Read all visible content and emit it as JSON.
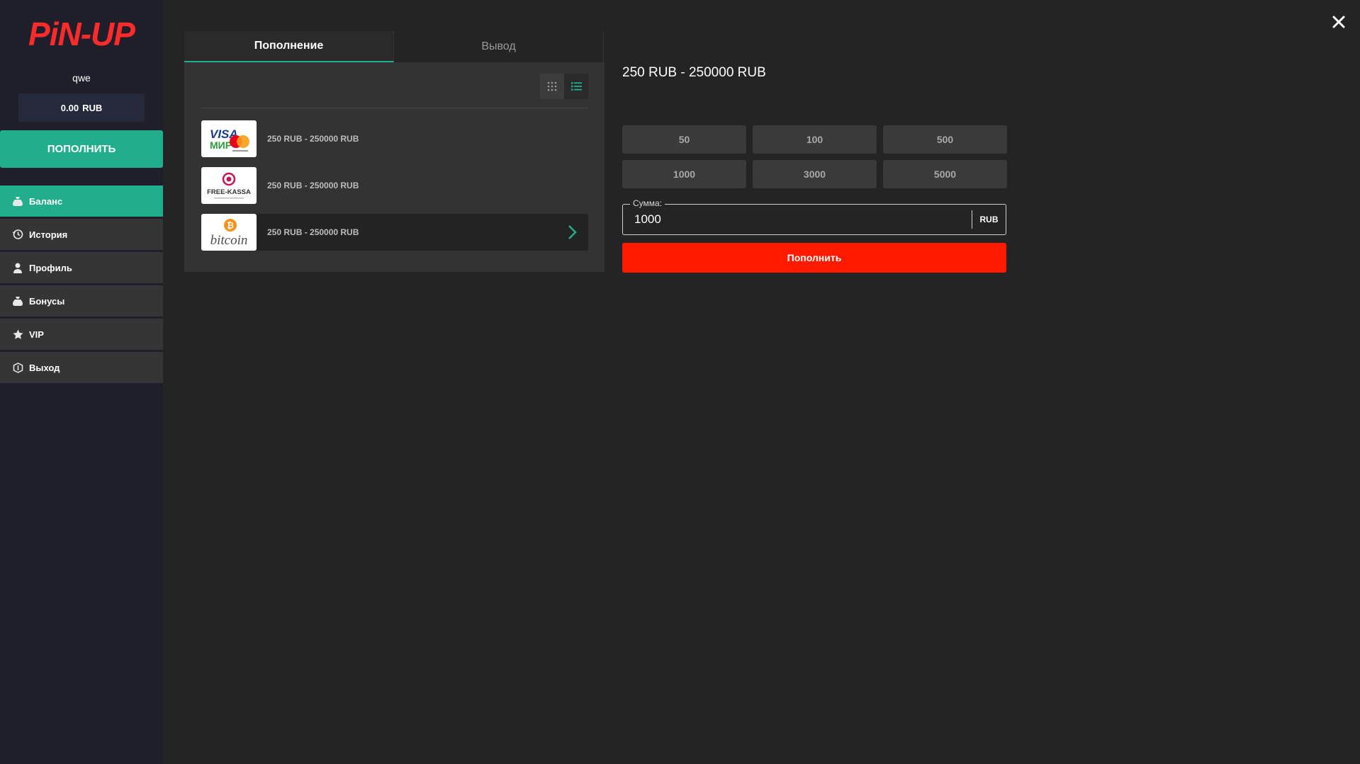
{
  "brand": {
    "logo_text": "PiN-UP",
    "logo_color": "#ff2a2a",
    "accent": "#21ae8c",
    "cta_color": "#ff1a00"
  },
  "user": {
    "name": "qwe",
    "balance": "0.00",
    "currency": "RUB"
  },
  "sidebar": {
    "deposit_label": "ПОПОЛНИТЬ",
    "items": [
      {
        "label": "Баланс",
        "icon": "money-bag-icon",
        "active": true
      },
      {
        "label": "История",
        "icon": "history-icon"
      },
      {
        "label": "Профиль",
        "icon": "user-icon"
      },
      {
        "label": "Бонусы",
        "icon": "bonus-bag-icon"
      },
      {
        "label": "VIP",
        "icon": "star-icon"
      },
      {
        "label": "Выход",
        "icon": "logout-icon"
      }
    ]
  },
  "tabs": [
    {
      "label": "Пополнение",
      "active": true
    },
    {
      "label": "Вывод"
    }
  ],
  "methods": [
    {
      "name": "visa-mir",
      "logo_text_1": "VISA",
      "logo_text_2": "МИР",
      "range": "250 RUB - 250000 RUB"
    },
    {
      "name": "free-kassa",
      "logo_text_1": "FREE-KASSA",
      "range": "250 RUB - 250000 RUB"
    },
    {
      "name": "bitcoin",
      "logo_text_1": "bitcoin",
      "range": "250 RUB - 250000 RUB",
      "selected": true
    }
  ],
  "amount": {
    "range_title": "250 RUB - 250000 RUB",
    "quick_values": [
      "50",
      "100",
      "500",
      "1000",
      "3000",
      "5000"
    ],
    "sum_label": "Сумма:",
    "sum_value": "1000",
    "currency": "RUB",
    "submit_label": "Пополнить"
  }
}
